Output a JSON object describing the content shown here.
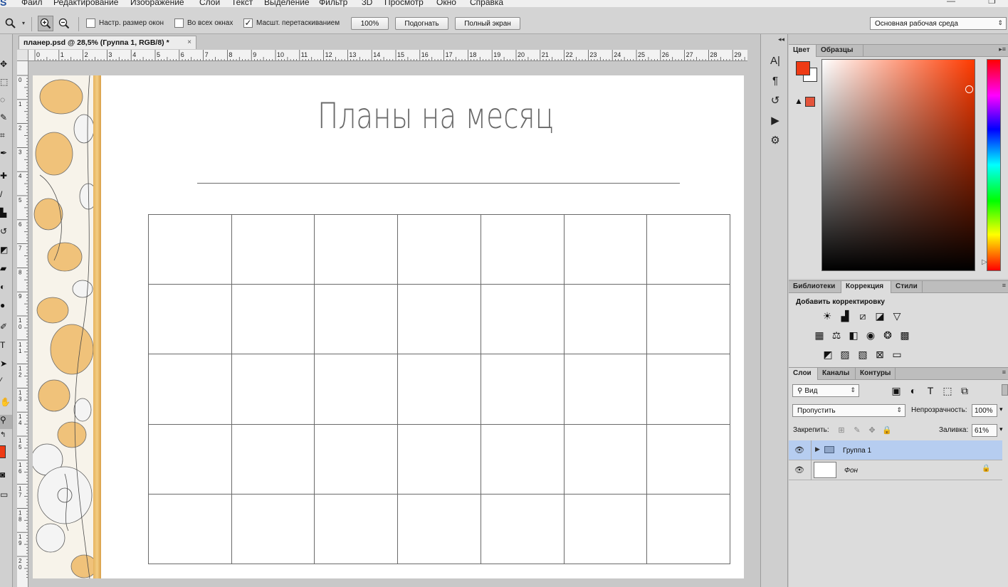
{
  "menubar": {
    "logo": "S",
    "items": [
      "Файл",
      "Редактирование",
      "Изображение",
      "Слои",
      "Текст",
      "Выделение",
      "Фильтр",
      "3D",
      "Просмотр",
      "Окно",
      "Справка"
    ]
  },
  "options_bar": {
    "tool_icon": "zoom-icon",
    "resize_windows_label": "Настр. размер окон",
    "resize_windows_checked": false,
    "all_windows_label": "Во всех окнах",
    "all_windows_checked": false,
    "scrubby_zoom_label": "Масшт. перетаскиванием",
    "scrubby_zoom_checked": true,
    "actual_pixels_button": "100%",
    "fit_screen_button": "Подогнать",
    "fill_screen_button": "Полный экран",
    "workspace_select": "Основная рабочая среда"
  },
  "document_tab": {
    "title": "планер.psd @ 28,5% (Группа 1, RGB/8) *",
    "close": "×"
  },
  "ruler_top_labels": [
    "0",
    "1",
    "2",
    "3",
    "4",
    "5",
    "6",
    "7",
    "8",
    "9",
    "10",
    "11",
    "12",
    "13",
    "14",
    "15",
    "16",
    "17",
    "18",
    "19",
    "20",
    "21",
    "22",
    "23",
    "24",
    "25",
    "26",
    "27",
    "28",
    "29"
  ],
  "ruler_left_labels": [
    "0",
    "1",
    "2",
    "3",
    "4",
    "5",
    "6",
    "7",
    "8",
    "9",
    "10",
    "11",
    "12",
    "13",
    "14",
    "15",
    "16",
    "17",
    "18",
    "19",
    "20"
  ],
  "document": {
    "title": "Планы на месяц",
    "calendar_rows": 5,
    "calendar_cols": 7
  },
  "color_panel": {
    "tabs": [
      "Цвет",
      "Образцы"
    ],
    "active_tab": "Цвет",
    "foreground_color": "#ee3a14",
    "background_color": "#ffffff"
  },
  "adjustments_panel": {
    "tabs": [
      "Библиотеки",
      "Коррекция",
      "Стили"
    ],
    "active_tab": "Коррекция",
    "heading": "Добавить корректировку"
  },
  "layers_panel": {
    "tabs": [
      "Слои",
      "Каналы",
      "Контуры"
    ],
    "active_tab": "Слои",
    "filter_select": "Вид",
    "blend_mode": "Пропустить",
    "opacity_label": "Непрозрачность:",
    "opacity_value": "100%",
    "lock_label": "Закрепить:",
    "fill_label": "Заливка:",
    "fill_value": "61%",
    "layers": [
      {
        "name": "Группа 1",
        "type": "group",
        "selected": true
      },
      {
        "name": "Фон",
        "type": "background",
        "locked": true
      }
    ]
  }
}
